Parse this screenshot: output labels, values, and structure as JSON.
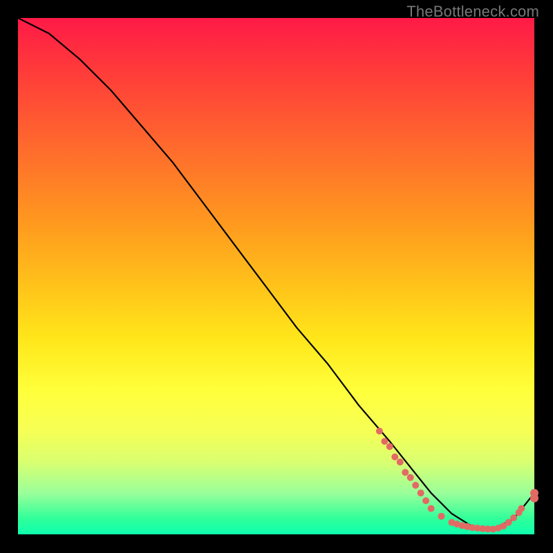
{
  "watermark": "TheBottleneck.com",
  "colors": {
    "dot": "#e26a65",
    "curve": "#000000",
    "background": "#000000"
  },
  "chart_data": {
    "type": "line",
    "title": "",
    "xlabel": "",
    "ylabel": "",
    "xlim": [
      0,
      100
    ],
    "ylim": [
      0,
      100
    ],
    "grid": false,
    "legend": false,
    "series": [
      {
        "name": "bottleneck-curve",
        "x": [
          0,
          6,
          12,
          18,
          24,
          30,
          36,
          42,
          48,
          54,
          60,
          66,
          72,
          76,
          80,
          84,
          88,
          92,
          96,
          100
        ],
        "y": [
          100,
          97,
          92,
          86,
          79,
          72,
          64,
          56,
          48,
          40,
          33,
          25,
          18,
          13,
          8,
          4,
          1.5,
          1,
          3,
          8
        ]
      }
    ],
    "markers": [
      {
        "x": 70,
        "y": 20
      },
      {
        "x": 71,
        "y": 18
      },
      {
        "x": 72,
        "y": 17
      },
      {
        "x": 73,
        "y": 15
      },
      {
        "x": 74,
        "y": 14
      },
      {
        "x": 75,
        "y": 12
      },
      {
        "x": 76,
        "y": 11
      },
      {
        "x": 77,
        "y": 9.5
      },
      {
        "x": 78,
        "y": 8
      },
      {
        "x": 79,
        "y": 6.5
      },
      {
        "x": 80,
        "y": 5
      },
      {
        "x": 82,
        "y": 3.5
      },
      {
        "x": 84,
        "y": 2.3
      },
      {
        "x": 85,
        "y": 2
      },
      {
        "x": 86,
        "y": 1.7
      },
      {
        "x": 87,
        "y": 1.5
      },
      {
        "x": 88,
        "y": 1.3
      },
      {
        "x": 89,
        "y": 1.2
      },
      {
        "x": 90,
        "y": 1.1
      },
      {
        "x": 91,
        "y": 1.05
      },
      {
        "x": 92,
        "y": 1
      },
      {
        "x": 93,
        "y": 1.2
      },
      {
        "x": 94,
        "y": 1.6
      },
      {
        "x": 95,
        "y": 2.3
      },
      {
        "x": 96,
        "y": 3.2
      },
      {
        "x": 97,
        "y": 4.2
      },
      {
        "x": 97.5,
        "y": 5
      },
      {
        "x": 100,
        "y": 8
      },
      {
        "x": 100,
        "y": 7
      }
    ],
    "annotations": []
  }
}
